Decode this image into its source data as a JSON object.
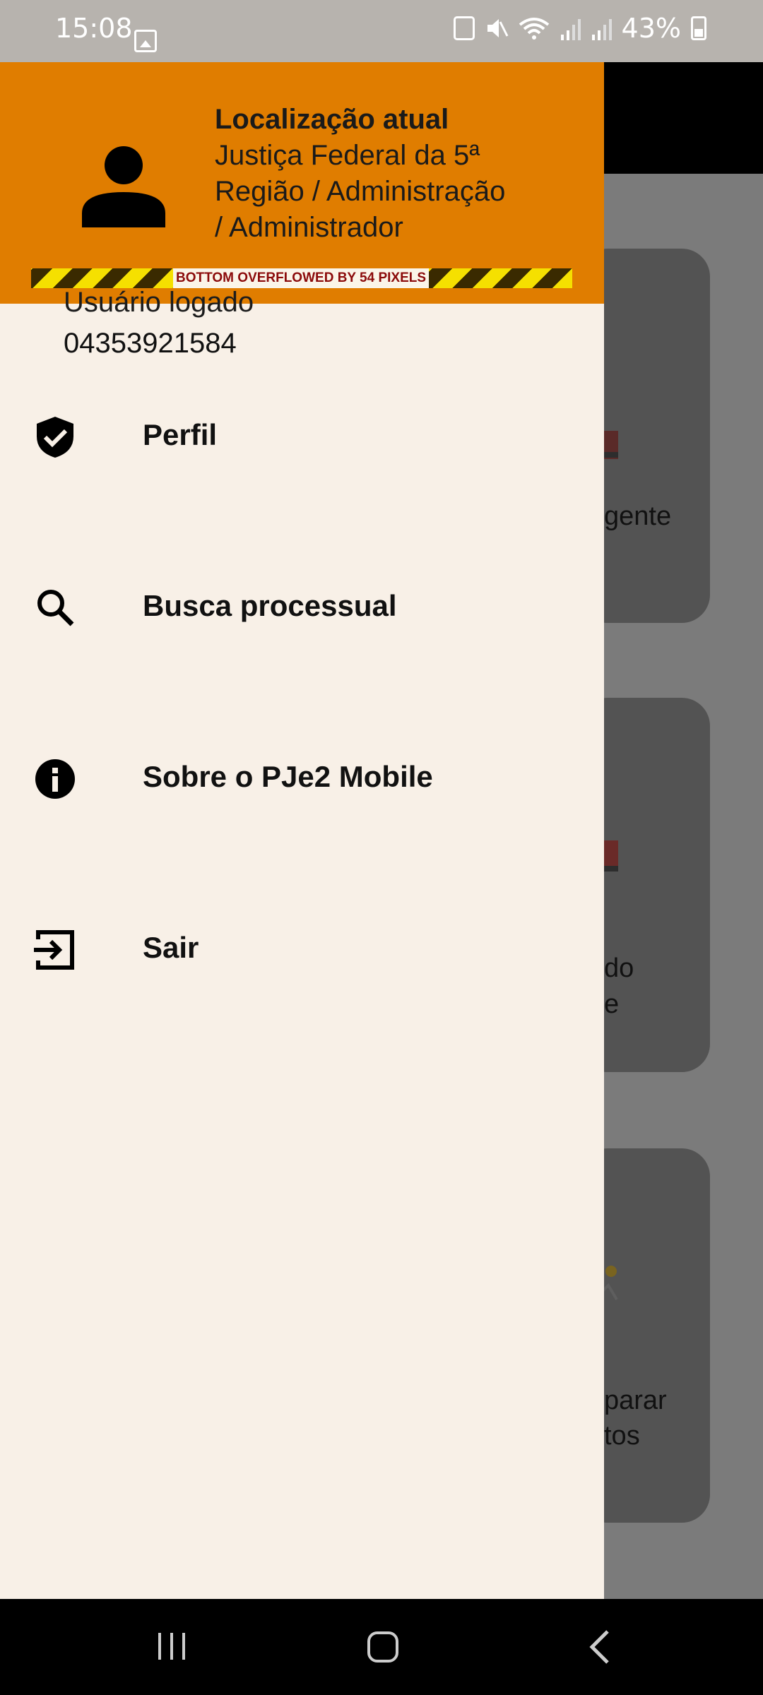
{
  "status_bar": {
    "time": "15:08",
    "battery": "43%",
    "icons": [
      "gallery-icon",
      "battery-saver-icon",
      "mute-icon",
      "wifi-icon",
      "signal-icon",
      "signal-icon",
      "battery-icon"
    ]
  },
  "drawer": {
    "header": {
      "title": "Localização atual",
      "line1": "Justiça Federal da 5ª",
      "line2": "Região / Administração",
      "line3": "/ Administrador",
      "avatar_icon": "person-icon",
      "background_color": "#e07d00"
    },
    "overflow_warning": "BOTTOM OVERFLOWED BY 54 PIXELS",
    "user": {
      "label": "Usuário logado",
      "value": "04353921584"
    },
    "menu": [
      {
        "label": "Perfil",
        "icon": "shield-check-icon"
      },
      {
        "label": "Busca processual",
        "icon": "search-icon"
      },
      {
        "label": "Sobre o PJe2 Mobile",
        "icon": "info-icon"
      },
      {
        "label": "Sair",
        "icon": "logout-icon"
      }
    ]
  },
  "background": {
    "card_texts": [
      "gente",
      "do",
      "e",
      "parar",
      "tos"
    ]
  },
  "nav_bar": {
    "icons": [
      "recents-icon",
      "home-icon",
      "back-icon"
    ]
  }
}
